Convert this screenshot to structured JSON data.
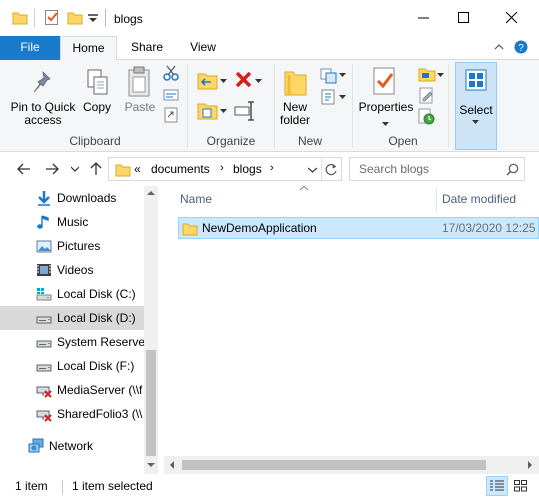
{
  "window": {
    "title": "blogs",
    "minimize_icon": "minimize-icon",
    "maximize_icon": "maximize-icon",
    "close_icon": "close-icon"
  },
  "ribbon_tabs": [
    {
      "label": "File",
      "active": false
    },
    {
      "label": "Home",
      "active": true
    },
    {
      "label": "Share",
      "active": false
    },
    {
      "label": "View",
      "active": false
    }
  ],
  "ribbon": {
    "clipboard": {
      "group_label": "Clipboard",
      "pin_line1": "Pin to Quick",
      "pin_line2": "access",
      "copy": "Copy",
      "paste": "Paste"
    },
    "organize": {
      "group_label": "Organize"
    },
    "new": {
      "group_label": "New",
      "new_folder_line1": "New",
      "new_folder_line2": "folder"
    },
    "open": {
      "group_label": "Open",
      "properties": "Properties"
    },
    "select": {
      "label": "Select"
    }
  },
  "address": {
    "prefix": "«",
    "crumbs": [
      "documents",
      "blogs"
    ],
    "search_placeholder": "Search blogs"
  },
  "nav_pane": {
    "items": [
      {
        "label": "Downloads",
        "icon": "download-arrow-icon"
      },
      {
        "label": "Music",
        "icon": "music-note-icon"
      },
      {
        "label": "Pictures",
        "icon": "pictures-icon"
      },
      {
        "label": "Videos",
        "icon": "videos-icon"
      },
      {
        "label": "Local Disk (C:)",
        "icon": "system-drive-icon"
      },
      {
        "label": "Local Disk (D:)",
        "icon": "drive-icon",
        "selected": true
      },
      {
        "label": "System Reserved",
        "icon": "drive-icon"
      },
      {
        "label": "Local Disk (F:)",
        "icon": "drive-icon"
      },
      {
        "label": "MediaServer (\\\\f",
        "icon": "network-drive-disconnected-icon"
      },
      {
        "label": "SharedFolio3 (\\\\",
        "icon": "network-drive-disconnected-icon"
      },
      {
        "label": "Network",
        "icon": "network-icon"
      }
    ]
  },
  "file_list": {
    "columns": [
      "Name",
      "Date modified"
    ],
    "rows": [
      {
        "name": "NewDemoApplication",
        "date_modified": "17/03/2020 12:25",
        "icon": "folder-icon",
        "selected": true
      }
    ]
  },
  "status_bar": {
    "item_count": "1 item",
    "selection": "1 item selected"
  },
  "colors": {
    "file_tab": "#1979ca",
    "selection": "#cce8ff",
    "selection_border": "#99d1ff",
    "folder": "#ffd766",
    "ribbon_bg": "#f5f6f7"
  }
}
